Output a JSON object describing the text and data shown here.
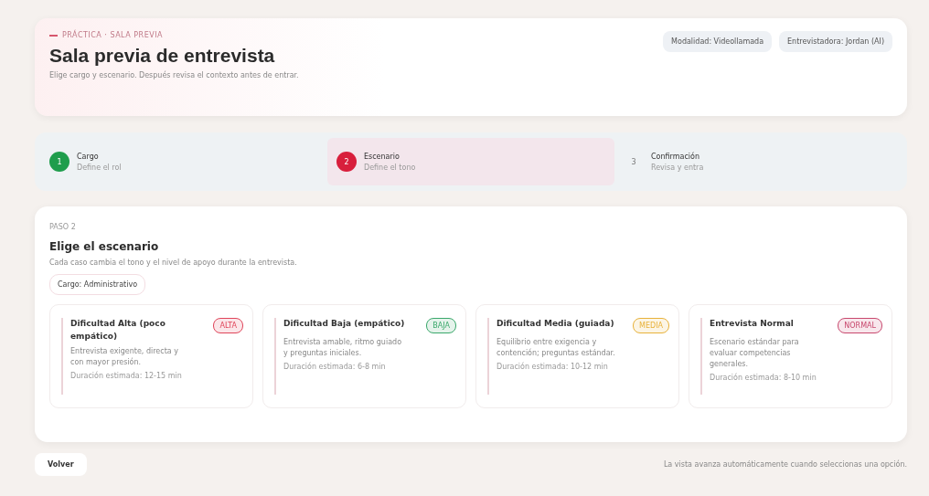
{
  "header": {
    "eyebrow": "PRÁCTICA · SALA PREVIA",
    "title": "Sala previa de entrevista",
    "subtitle": "Elige cargo y escenario. Después revisa el contexto antes de entrar.",
    "chips": [
      "Modalidad: Videollamada",
      "Entrevistadora: Jordan (AI)"
    ]
  },
  "steps": [
    {
      "number": "1",
      "label": "Cargo",
      "hint": "Define el rol",
      "done": true,
      "selected": false
    },
    {
      "number": "2",
      "label": "Escenario",
      "hint": "Define el tono",
      "done": false,
      "selected": true
    },
    {
      "number": "3",
      "label": "Confirmación",
      "hint": "Revisa y entra",
      "done": false,
      "selected": false
    }
  ],
  "panel": {
    "step": "PASO 2",
    "title": "Elige el escenario",
    "description": "Cada caso cambia el tono y el nivel de apoyo durante la entrevista.",
    "role_chip": "Cargo: Administrativo",
    "scenarios": [
      {
        "title": "Dificultad Alta (poco empático)",
        "badge": "ALTA",
        "color": "#e0455a",
        "description": "Entrevista exigente, directa y con mayor presión.",
        "duration": "Duración estimada: 12-15 min"
      },
      {
        "title": "Dificultad Baja (empático)",
        "badge": "BAJA",
        "color": "#3aa86b",
        "description": "Entrevista amable, ritmo guiado y preguntas iniciales.",
        "duration": "Duración estimada: 6-8 min"
      },
      {
        "title": "Dificultad Media (guiada)",
        "badge": "MEDIA",
        "color": "#e8b23a",
        "description": "Equilibrio entre exigencia y contención; preguntas estándar.",
        "duration": "Duración estimada: 10-12 min"
      },
      {
        "title": "Entrevista Normal",
        "badge": "NORMAL",
        "color": "#c8486e",
        "description": "Escenario estándar para evaluar competencias generales.",
        "duration": "Duración estimada: 8-10 min"
      }
    ]
  },
  "footer": {
    "back_button": "Volver",
    "note": "La vista avanza automáticamente cuando seleccionas una opción."
  }
}
